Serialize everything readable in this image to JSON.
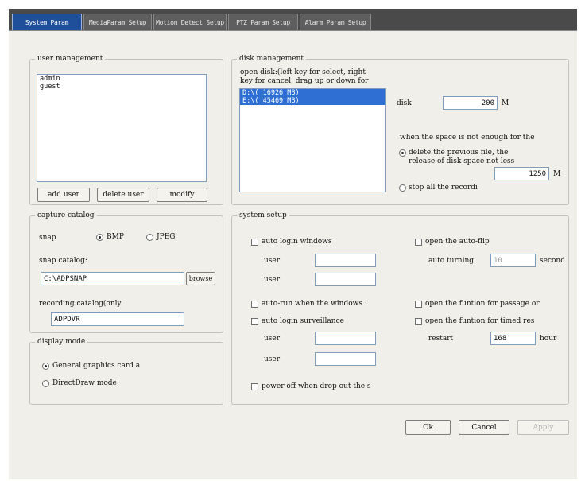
{
  "tabs": [
    {
      "label": "System Param",
      "active": true
    },
    {
      "label": "MediaParam Setup",
      "active": false
    },
    {
      "label": "Motion Detect Setup",
      "active": false
    },
    {
      "label": "PTZ Param Setup",
      "active": false
    },
    {
      "label": "Alarm Param Setup",
      "active": false
    }
  ],
  "user_management": {
    "title": "user management",
    "users": [
      "admin",
      "guest"
    ],
    "add_label": "add user",
    "delete_label": "delete user",
    "modify_label": "modify"
  },
  "disk_management": {
    "title": "disk management",
    "hint_line1": "open disk:(left key for select, right",
    "hint_line2": "key for cancel, drag up or down for",
    "disks": [
      {
        "label": "D:\\( 16926 MB)",
        "selected": true
      },
      {
        "label": "E:\\( 45469 MB)",
        "selected": true
      }
    ],
    "disk_label": "disk",
    "disk_value": "200",
    "disk_unit": "M",
    "space_note": "when the space is not enough for the",
    "delete_line1": "delete the previous file, the",
    "delete_line2": "release of disk space not less",
    "release_value": "1250",
    "release_unit": "M",
    "stop_label": "stop all the recordi"
  },
  "capture_catalog": {
    "title": "capture catalog",
    "snap_label": "snap",
    "bmp_label": "BMP",
    "jpeg_label": "JPEG",
    "snap_catalog_label": "snap catalog:",
    "snap_path": "C:\\ADPSNAP",
    "browse_label": "browse",
    "recording_label": "recording catalog(only",
    "recording_path": "ADPDVR"
  },
  "display_mode": {
    "title": "display mode",
    "general_label": "General graphics card a",
    "directdraw_label": "DirectDraw mode"
  },
  "system_setup": {
    "title": "system setup",
    "auto_login_windows": "auto login windows",
    "user1_label": "user",
    "user2_label": "user",
    "auto_run": "auto-run when the windows :",
    "auto_login_surveillance": "auto login surveillance",
    "user3_label": "user",
    "user4_label": "user",
    "power_off": "power off when drop out the s",
    "auto_flip": "open the auto-flip",
    "auto_turning_label": "auto turning",
    "auto_turning_value": "10",
    "second_label": "second",
    "passage_label": "open the funtion for passage or",
    "timed_label": "open the funtion for timed res",
    "restart_label": "restart",
    "restart_value": "168",
    "hour_label": "hour"
  },
  "footer": {
    "ok_label": "Ok",
    "cancel_label": "Cancel",
    "apply_label": "Apply"
  },
  "colors": {
    "tab_active": "#1f4f9a",
    "selection": "#2f6fd4",
    "panel_bg": "#f0efea"
  }
}
